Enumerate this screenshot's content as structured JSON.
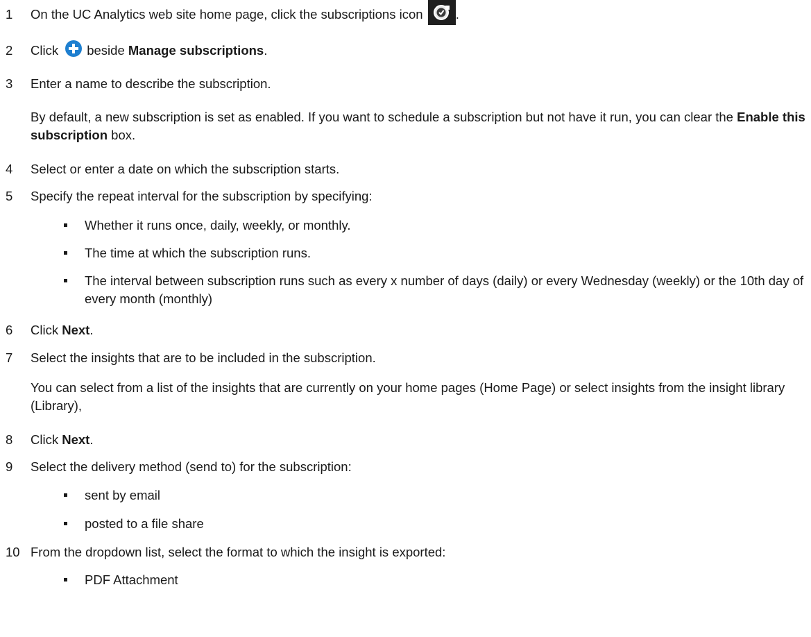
{
  "steps": [
    {
      "num": "1",
      "text_a": "On the UC Analytics web site home page, click the subscriptions icon",
      "text_b": "."
    },
    {
      "num": "2",
      "text_a": "Click",
      "text_b": "beside",
      "bold": "Manage subscriptions",
      "text_c": "."
    },
    {
      "num": "3",
      "text": "Enter a name to describe the subscription.",
      "note_a": "By default, a new subscription is set as enabled. If you want to schedule a subscription but not have it run, you can clear the",
      "note_bold": "Enable this subscription",
      "note_b": "box."
    },
    {
      "num": "4",
      "text": "Select or enter a date on which the subscription starts."
    },
    {
      "num": "5",
      "text": "Specify the repeat interval for the subscription by specifying:",
      "bullets": [
        "Whether it runs once, daily, weekly, or monthly.",
        "The time at which the subscription runs.",
        "The interval between subscription runs such as every x number of days (daily) or every Wednesday (weekly) or the 10th day of every month (monthly)"
      ]
    },
    {
      "num": "6",
      "text_a": "Click",
      "bold": "Next",
      "text_b": "."
    },
    {
      "num": "7",
      "text": "Select the insights that are to be included in the subscription.",
      "note": "You can select from a list of the insights that are currently on your home pages (Home Page) or select insights from the insight library (Library),"
    },
    {
      "num": "8",
      "text_a": "Click",
      "bold": "Next",
      "text_b": "."
    },
    {
      "num": "9",
      "text": "Select the delivery method (send to) for the subscription:",
      "bullets": [
        "sent by email",
        "posted to a file share"
      ]
    },
    {
      "num": "10",
      "text": "From the dropdown list, select the format to which the insight is exported:",
      "bullets": [
        "PDF Attachment"
      ]
    }
  ],
  "icons": {
    "subscriptions_icon": "subscriptions-icon",
    "add_icon": "plus-circle-icon",
    "add_icon_color": "#1e7fd0"
  }
}
